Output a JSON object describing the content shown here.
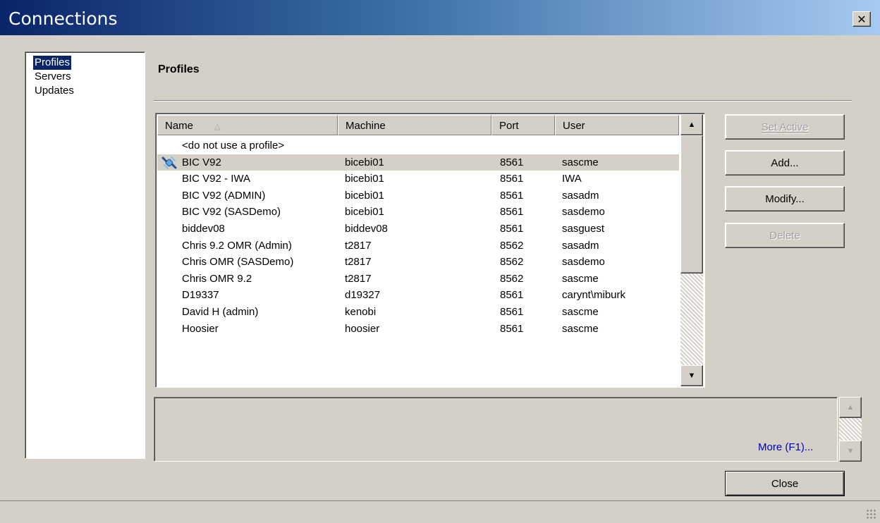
{
  "window": {
    "title": "Connections",
    "close_glyph": "✕"
  },
  "nav": {
    "items": [
      {
        "label": "Profiles",
        "selected": true
      },
      {
        "label": "Servers",
        "selected": false
      },
      {
        "label": "Updates",
        "selected": false
      }
    ]
  },
  "section": {
    "title": "Profiles"
  },
  "list": {
    "columns": [
      "Name",
      "Machine",
      "Port",
      "User"
    ],
    "sort_indicator": "△",
    "rows": [
      {
        "name": "<do not use a profile>",
        "machine": "",
        "port": "",
        "user": "",
        "active": false
      },
      {
        "name": "BIC V92",
        "machine": "bicebi01",
        "port": "8561",
        "user": "sascme",
        "active": true,
        "icon": "connected-plug-icon"
      },
      {
        "name": "BIC V92 - IWA",
        "machine": "bicebi01",
        "port": "8561",
        "user": "IWA",
        "active": false
      },
      {
        "name": "BIC V92 (ADMIN)",
        "machine": "bicebi01",
        "port": "8561",
        "user": "sasadm",
        "active": false
      },
      {
        "name": "BIC V92 (SASDemo)",
        "machine": "bicebi01",
        "port": "8561",
        "user": "sasdemo",
        "active": false
      },
      {
        "name": "biddev08",
        "machine": "biddev08",
        "port": "8561",
        "user": "sasguest",
        "active": false
      },
      {
        "name": "Chris 9.2 OMR (Admin)",
        "machine": "t2817",
        "port": "8562",
        "user": "sasadm",
        "active": false
      },
      {
        "name": "Chris OMR (SASDemo)",
        "machine": "t2817",
        "port": "8562",
        "user": "sasdemo",
        "active": false
      },
      {
        "name": "Chris OMR 9.2",
        "machine": "t2817",
        "port": "8562",
        "user": "sascme",
        "active": false
      },
      {
        "name": "D19337",
        "machine": "d19327",
        "port": "8561",
        "user": "carynt\\miburk",
        "active": false
      },
      {
        "name": "David H (admin)",
        "machine": "kenobi",
        "port": "8561",
        "user": "sascme",
        "active": false
      },
      {
        "name": "Hoosier",
        "machine": "hoosier",
        "port": "8561",
        "user": "sascme",
        "active": false
      }
    ]
  },
  "buttons": {
    "set_active": "Set Active",
    "add": "Add...",
    "modify": "Modify...",
    "delete": "Delete",
    "close": "Close"
  },
  "description": {
    "more_link": "More (F1)..."
  },
  "icons": {
    "scroll_up": "▲",
    "scroll_down": "▼"
  }
}
